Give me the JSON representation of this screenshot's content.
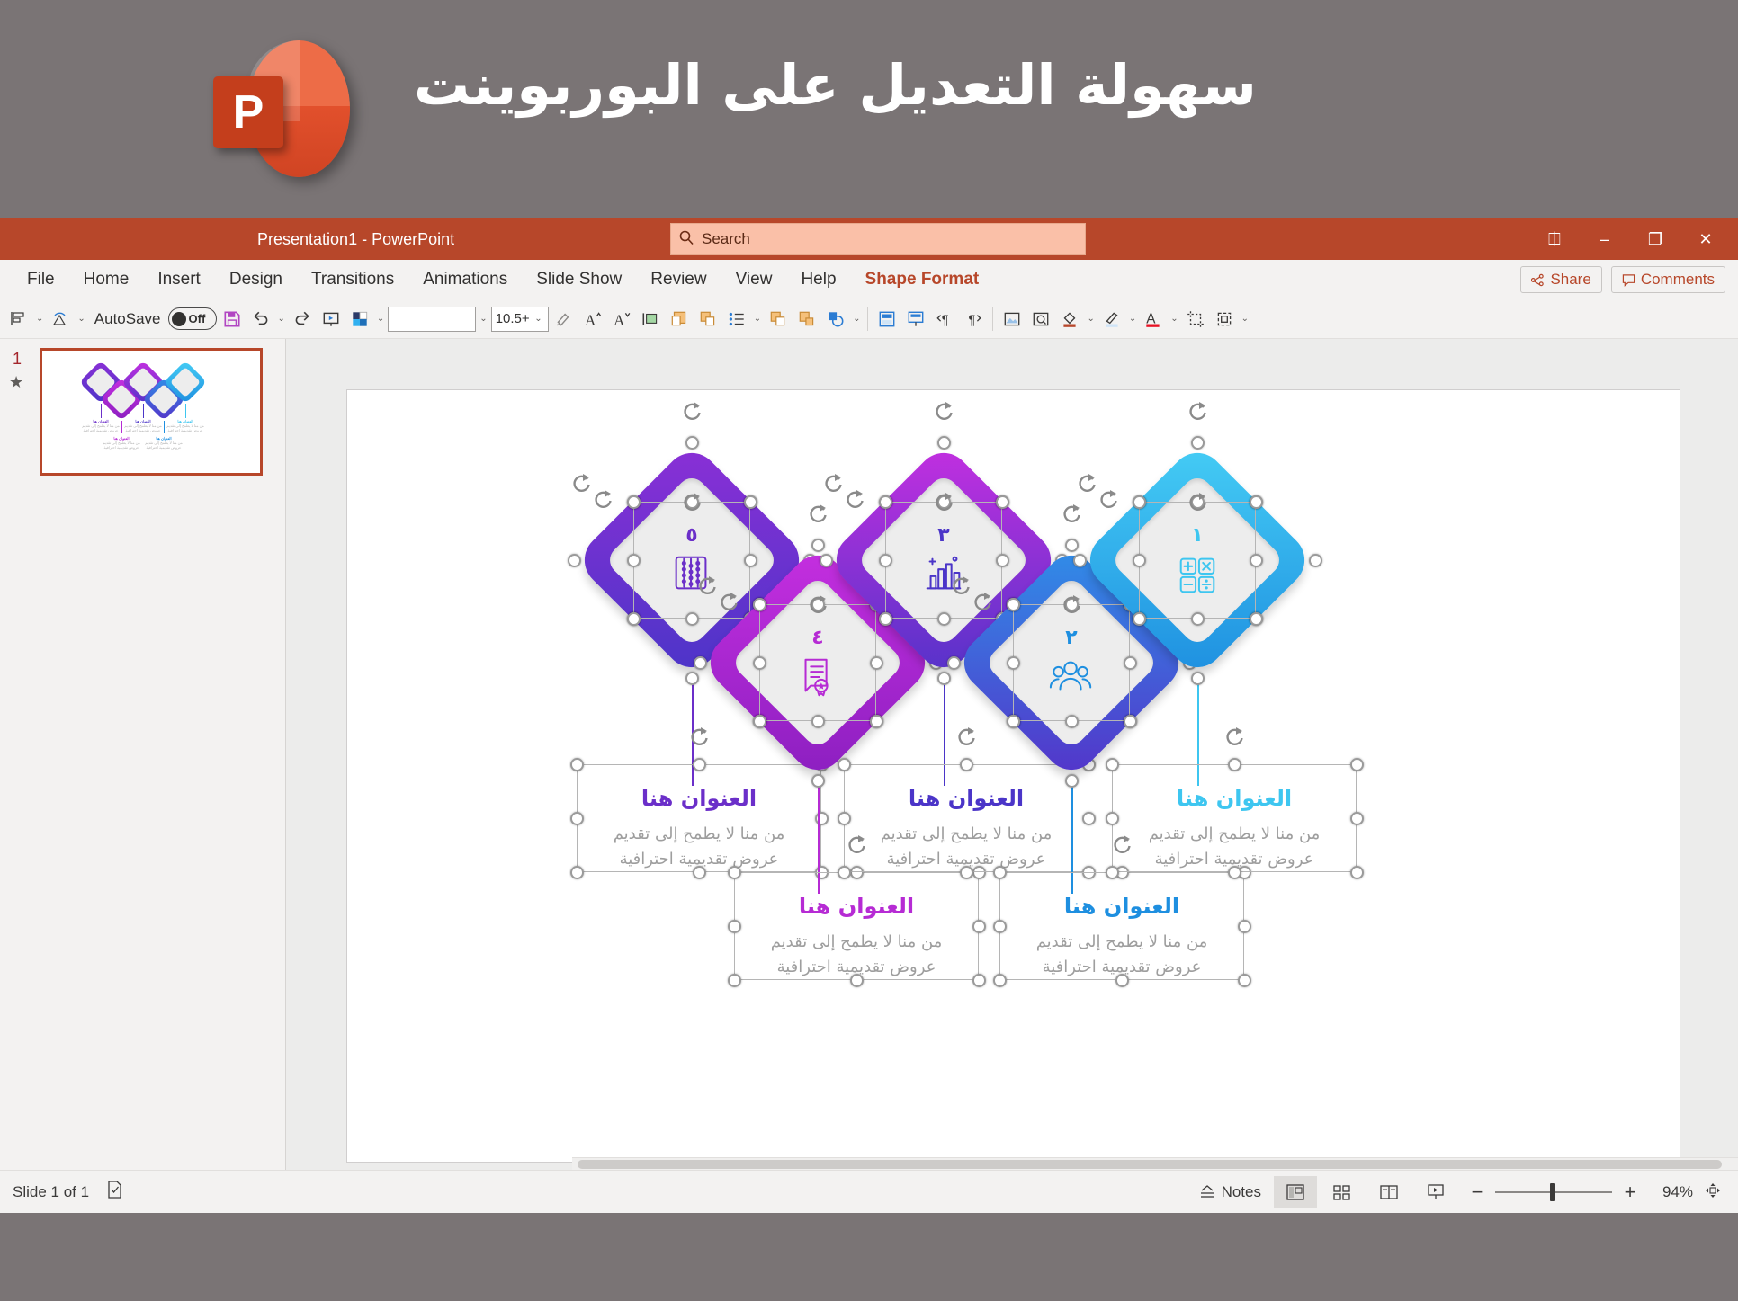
{
  "banner": {
    "title": "سهولة التعديل على البوربوينت",
    "logo_letter": "P",
    "bg_color": "#7a7475"
  },
  "titlebar": {
    "document_title": "Presentation1  -  PowerPoint",
    "search_placeholder": "Search",
    "search_icon": "search-icon",
    "ribbon_display_icon": "⎅",
    "minimize_icon": "–",
    "restore_icon": "❐",
    "close_icon": "✕",
    "bg_color": "#b7472a"
  },
  "ribbon": {
    "tabs": [
      {
        "label": "File",
        "active": false
      },
      {
        "label": "Home",
        "active": false
      },
      {
        "label": "Insert",
        "active": false
      },
      {
        "label": "Design",
        "active": false
      },
      {
        "label": "Transitions",
        "active": false
      },
      {
        "label": "Animations",
        "active": false
      },
      {
        "label": "Slide Show",
        "active": false
      },
      {
        "label": "Review",
        "active": false
      },
      {
        "label": "View",
        "active": false
      },
      {
        "label": "Help",
        "active": false
      },
      {
        "label": "Shape Format",
        "active": true
      }
    ],
    "share_label": "Share",
    "comments_label": "Comments",
    "active_tab_color": "#b7472a"
  },
  "toolbar": {
    "autosave_label": "AutoSave",
    "autosave_state": "Off",
    "font_name": "",
    "font_size": "10.5+",
    "icons": [
      "align-object-icon",
      "rotate-object-icon",
      "save-icon",
      "undo-icon",
      "redo-icon",
      "start-slideshow-icon",
      "theme-colors-icon",
      "format-painter-icon",
      "increase-font-size-icon",
      "decrease-font-size-icon",
      "align-text-icon",
      "shape-fill-icon",
      "shape-outline-icon",
      "bullets-icon",
      "bring-forward-icon",
      "send-backward-icon",
      "shapes-icon",
      "layout-icon",
      "slide-master-icon",
      "rtl-text-icon",
      "ltr-text-icon",
      "picture-icon",
      "zoom-icon",
      "fill-color-icon",
      "pen-color-icon",
      "font-color-icon",
      "crop-icon",
      "group-objects-icon",
      "more-options-icon"
    ]
  },
  "thumbnail_pane": {
    "slide_number": "1",
    "star_icon": "animation-star-icon"
  },
  "slide": {
    "items": [
      {
        "number": "٥",
        "title": "العنوان هنا",
        "body": "من منا لا يطمح إلى تقديم\nعروض تقديمية احترافية",
        "color": "#6b2fc9",
        "gradient_from": "#8b2fd6",
        "gradient_to": "#4b35c8",
        "icon": "abacus-icon",
        "row": "top"
      },
      {
        "number": "٤",
        "title": "العنوان هنا",
        "body": "من منا لا يطمح إلى تقديم\nعروض تقديمية احترافية",
        "color": "#b62bd4",
        "gradient_from": "#c62fe0",
        "gradient_to": "#8b1fc0",
        "icon": "certificate-icon",
        "row": "bottom"
      },
      {
        "number": "٣",
        "title": "العنوان هنا",
        "body": "من منا لا يطمح إلى تقديم\nعروض تقديمية احترافية",
        "color": "#4b35c8",
        "gradient_from": "#c42fe0",
        "gradient_to": "#5433c9",
        "icon": "bar-chart-icon",
        "row": "top"
      },
      {
        "number": "٢",
        "title": "العنوان هنا",
        "body": "من منا لا يطمح إلى تقديم\nعروض تقديمية احترافية",
        "color": "#1e8fe0",
        "gradient_from": "#2f8fe8",
        "gradient_to": "#5433c9",
        "icon": "people-group-icon",
        "row": "bottom"
      },
      {
        "number": "١",
        "title": "العنوان هنا",
        "body": "من منا لا يطمح إلى تقديم\nعروض تقديمية احترافية",
        "color": "#3ec6f0",
        "gradient_from": "#45cdf5",
        "gradient_to": "#1e8fe0",
        "icon": "calculator-icon",
        "row": "top"
      }
    ]
  },
  "statusbar": {
    "slide_count": "Slide 1 of 1",
    "accessibility_icon": "accessibility-checker-icon",
    "notes_label": "Notes",
    "views": [
      {
        "name": "normal-view",
        "icon": "normal-view-icon",
        "selected": true
      },
      {
        "name": "slide-sorter-view",
        "icon": "slide-sorter-icon",
        "selected": false
      },
      {
        "name": "reading-view",
        "icon": "reading-view-icon",
        "selected": false
      },
      {
        "name": "slideshow-view",
        "icon": "slideshow-icon",
        "selected": false
      }
    ],
    "zoom_out_icon": "−",
    "zoom_in_icon": "+",
    "zoom_level": "94%",
    "fit_slide_icon": "fit-to-window-icon"
  }
}
